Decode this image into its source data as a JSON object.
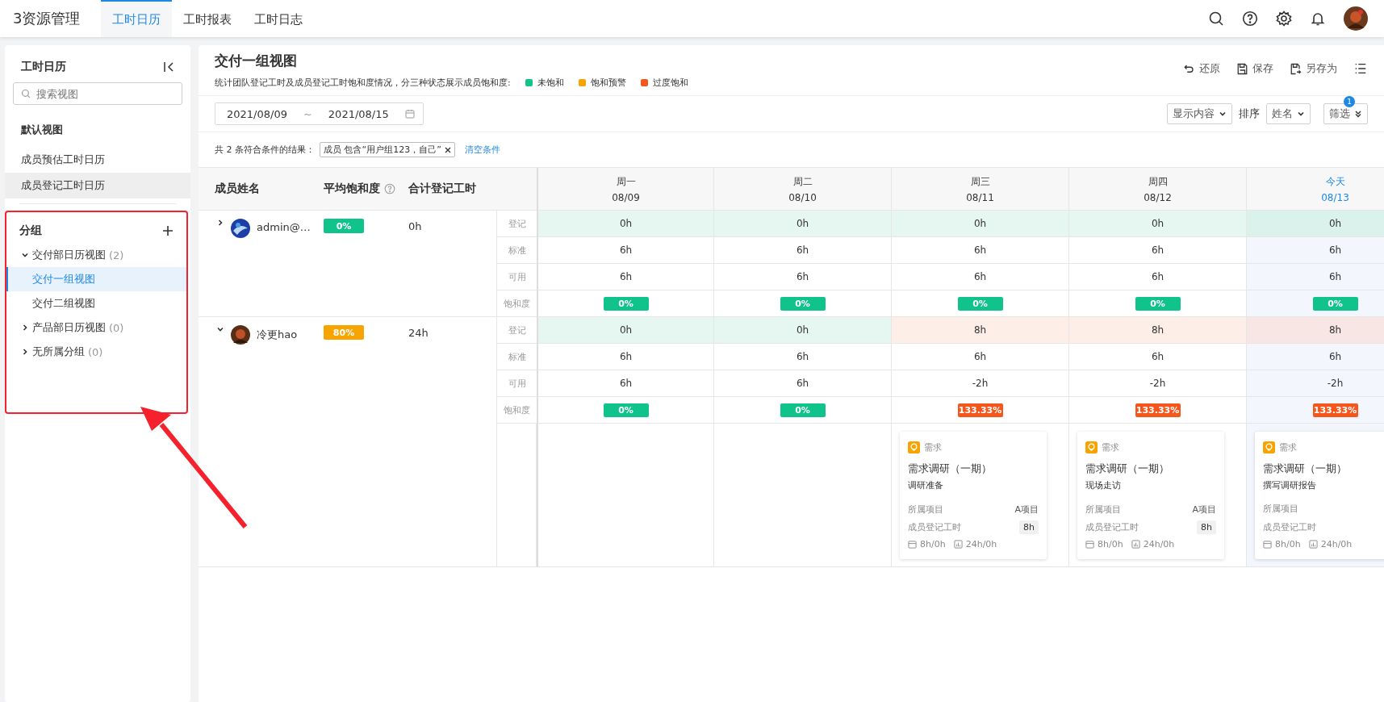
{
  "app": {
    "logo": "3资源管理",
    "tabs": [
      {
        "label": "工时日历",
        "selected": true
      },
      {
        "label": "工时报表",
        "selected": false
      },
      {
        "label": "工时日志",
        "selected": false
      }
    ]
  },
  "sidebar": {
    "title": "工时日历",
    "search": {
      "placeholder": "搜索视图"
    },
    "default_section": "默认视图",
    "default_items": [
      {
        "label": "成员预估工时日历",
        "selected": false
      },
      {
        "label": "成员登记工时日历",
        "selected": true
      }
    ],
    "group_section": "分组",
    "highlighted": true,
    "groups": [
      {
        "label": "交付部日历视图",
        "count": "(2)",
        "expanded": true,
        "children": [
          {
            "label": "交付一组视图",
            "selected": true
          },
          {
            "label": "交付二组视图",
            "selected": false
          }
        ]
      },
      {
        "label": "产品部日历视图",
        "count": "(0)",
        "expanded": false
      },
      {
        "label": "无所属分组",
        "count": "(0)",
        "expanded": false
      }
    ]
  },
  "view": {
    "title": "交付一组视图",
    "description": "统计团队登记工时及成员登记工时饱和度情况，分三种状态展示成员饱和度:",
    "legend": [
      {
        "label": "未饱和",
        "color": "#10c38a"
      },
      {
        "label": "饱和预警",
        "color": "#f7a400"
      },
      {
        "label": "过度饱和",
        "color": "#f5561b"
      }
    ],
    "actions": [
      "还原",
      "保存",
      "另存为"
    ],
    "date_from": "2021/08/09",
    "date_sep": "~",
    "date_to": "2021/08/15",
    "display_select": "显示内容",
    "sort_label": "排序",
    "sort_select": "姓名",
    "filter_button": "筛选",
    "filter_badge": "1",
    "result_text": "共 2 条符合条件的结果：",
    "filter_tag": "成员 包含“用户组123，自己”",
    "clear_link": "清空条件"
  },
  "table": {
    "columns": [
      "成员姓名",
      "平均饱和度",
      "合计登记工时"
    ],
    "days": [
      {
        "weekday": "周一",
        "date": "08/09",
        "today": false
      },
      {
        "weekday": "周二",
        "date": "08/10",
        "today": false
      },
      {
        "weekday": "周三",
        "date": "08/11",
        "today": false
      },
      {
        "weekday": "周四",
        "date": "08/12",
        "today": false
      },
      {
        "weekday": "今天",
        "date": "08/13",
        "today": true
      }
    ],
    "members": [
      {
        "name": "admin@…",
        "expanded": false,
        "avg": {
          "value": "0%",
          "color": "#10c38a"
        },
        "total": "0h",
        "row_labels": [
          "登记",
          "标准",
          "可用",
          "饱和度"
        ],
        "registered": [
          {
            "value": "0h",
            "color": "#e6f7f1"
          },
          {
            "value": "0h",
            "color": "#e6f7f1"
          },
          {
            "value": "0h",
            "color": "#e6f7f1"
          },
          {
            "value": "0h",
            "color": "#e6f7f1"
          },
          {
            "value": "0h",
            "color": "#daf1ec"
          }
        ],
        "standard": [
          "6h",
          "6h",
          "6h",
          "6h",
          "6h"
        ],
        "available": [
          "6h",
          "6h",
          "6h",
          "6h",
          "6h"
        ],
        "saturation": [
          {
            "value": "0%",
            "color": "#10c38a"
          },
          {
            "value": "0%",
            "color": "#10c38a"
          },
          {
            "value": "0%",
            "color": "#10c38a"
          },
          {
            "value": "0%",
            "color": "#10c38a"
          },
          {
            "value": "0%",
            "color": "#10c38a"
          }
        ]
      },
      {
        "name": "冷更hao",
        "expanded": true,
        "avg": {
          "value": "80%",
          "color": "#f7a400"
        },
        "total": "24h",
        "row_labels": [
          "登记",
          "标准",
          "可用",
          "饱和度"
        ],
        "registered": [
          {
            "value": "0h",
            "color": "#e6f7f1"
          },
          {
            "value": "0h",
            "color": "#e6f7f1"
          },
          {
            "value": "8h",
            "color": "#fdeee8"
          },
          {
            "value": "8h",
            "color": "#fdeee8"
          },
          {
            "value": "8h",
            "color": "#f7e6e4"
          }
        ],
        "standard": [
          "6h",
          "6h",
          "6h",
          "6h",
          "6h"
        ],
        "available": [
          "6h",
          "6h",
          "-2h",
          "-2h",
          "-2h"
        ],
        "saturation": [
          {
            "value": "0%",
            "color": "#10c38a"
          },
          {
            "value": "0%",
            "color": "#10c38a"
          },
          {
            "value": "133.33%",
            "color": "#f5561b"
          },
          {
            "value": "133.33%",
            "color": "#f5561b"
          },
          {
            "value": "133.33%",
            "color": "#f5561b"
          }
        ],
        "tasks": [
          {
            "type": "需求",
            "title": "需求调研（一期）",
            "subtitle": "调研准备",
            "project_label": "所属项目",
            "project": "A项目",
            "hours_label": "成员登记工时",
            "hours": "8h",
            "plan": "8h/0h",
            "sum": "24h/0h"
          },
          {
            "type": "需求",
            "title": "需求调研（一期）",
            "subtitle": "现场走访",
            "project_label": "所属项目",
            "project": "A项目",
            "hours_label": "成员登记工时",
            "hours": "8h",
            "plan": "8h/0h",
            "sum": "24h/0h"
          },
          {
            "type": "需求",
            "title": "需求调研（一期）",
            "subtitle": "撰写调研报告",
            "project_label": "所属项目",
            "hours_label": "成员登记工时",
            "plan": "8h/0h",
            "sum": "24h/0h"
          }
        ]
      }
    ]
  }
}
